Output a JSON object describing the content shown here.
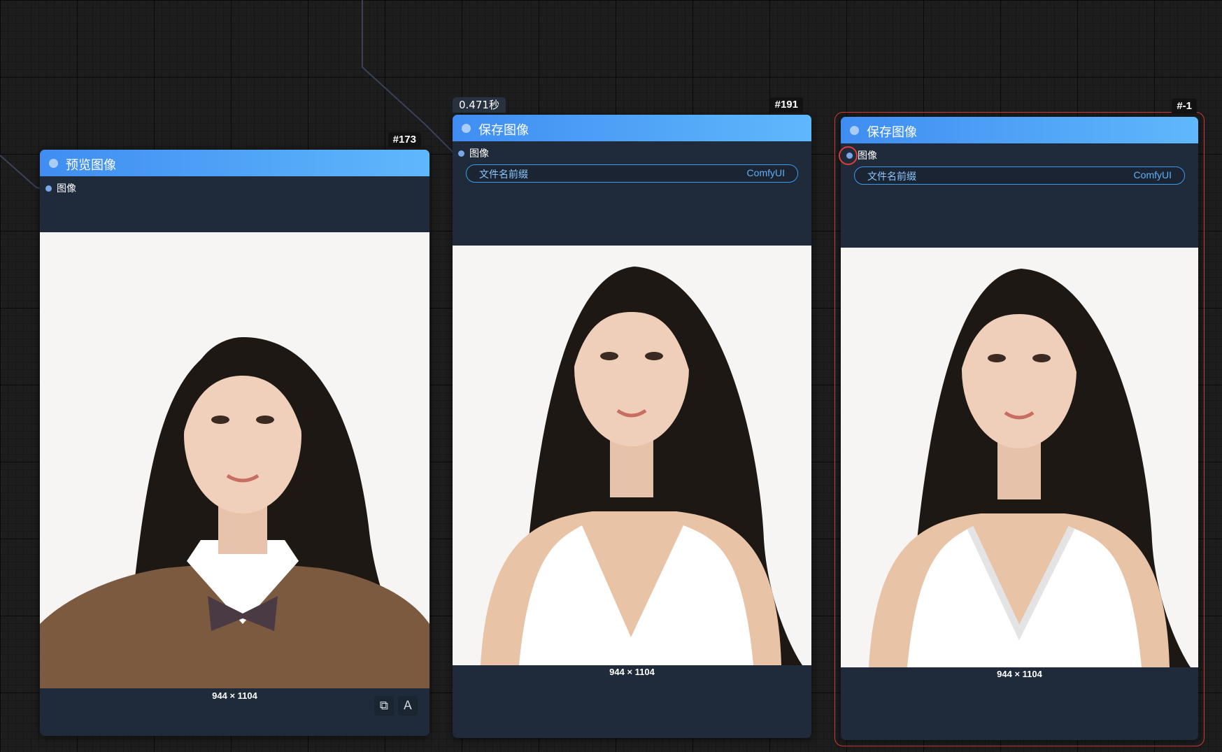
{
  "canvas": {
    "background": "#1d1d1d",
    "link_color": "#3c4058"
  },
  "nodes": [
    {
      "id": "#173",
      "title": "预览图像",
      "header_color": "#4a9ff6",
      "input_slot": "图像",
      "image_dims": "944 × 1104",
      "image_toolbar": [
        "image-mask-icon",
        "image-text-icon"
      ]
    },
    {
      "id": "#191",
      "exec_time": "0.471秒",
      "title": "保存图像",
      "header_color": "#4a9ff6",
      "input_slot": "图像",
      "widget": {
        "label": "文件名前缀",
        "value": "ComfyUI"
      },
      "image_dims": "944 × 1104"
    },
    {
      "id": "#-1",
      "title": "保存图像",
      "header_color": "#4a9ff6",
      "input_slot": "图像",
      "widget": {
        "label": "文件名前缀",
        "value": "ComfyUI"
      },
      "image_dims": "944 × 1104",
      "selected": true,
      "selection_color": "#d13a38"
    }
  ]
}
